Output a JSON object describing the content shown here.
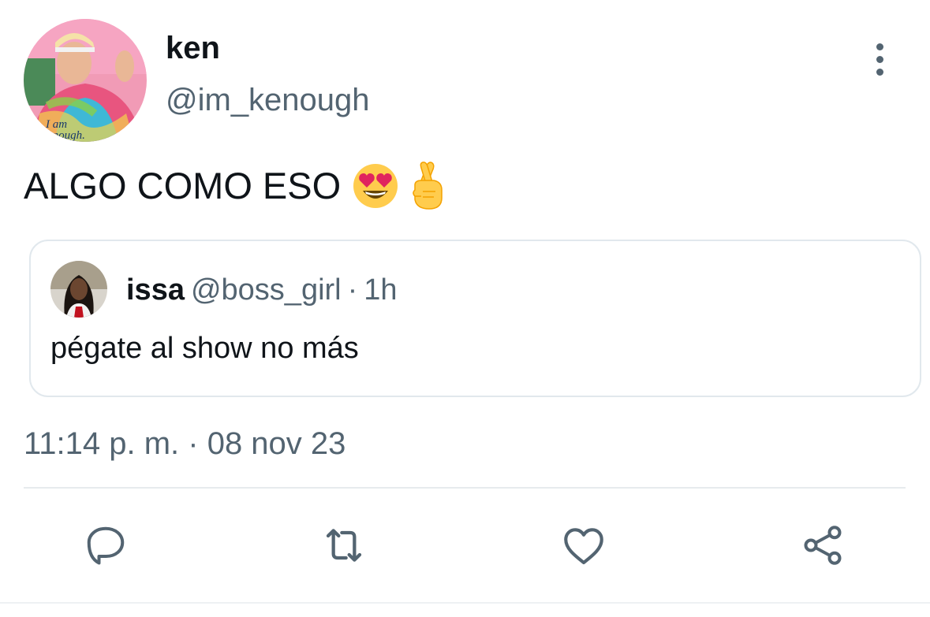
{
  "author": {
    "name": "ken",
    "handle": "@im_kenough",
    "avatar_caption": "I am Kenough."
  },
  "tweet": {
    "text": "ALGO COMO ESO",
    "emojis": [
      "smiling-face-with-heart-eyes",
      "crossed-fingers"
    ]
  },
  "quoted_tweet": {
    "name": "issa",
    "handle": "@boss_girl",
    "separator": "·",
    "time": "1h",
    "text": "pégate al show no más"
  },
  "timestamp": "11:14 p. m. · 08 nov 23",
  "actions": {
    "icons": [
      "reply-icon",
      "retweet-icon",
      "like-icon",
      "share-icon"
    ]
  },
  "colors": {
    "text_primary": "#0f1419",
    "text_secondary": "#536471",
    "border": "#e1e8ed"
  }
}
